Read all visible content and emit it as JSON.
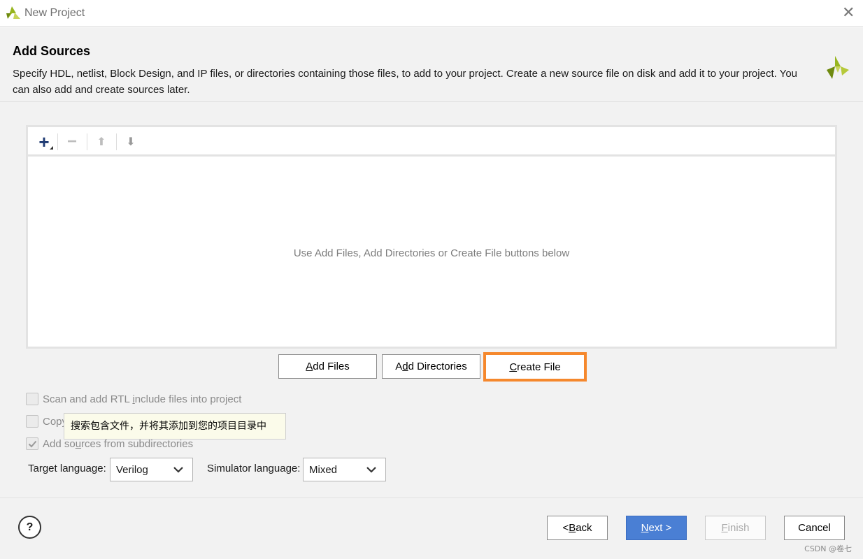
{
  "window": {
    "title": "New Project",
    "close_glyph": "✕"
  },
  "header": {
    "title": "Add Sources",
    "description": "Specify HDL, netlist, Block Design, and IP files, or directories containing those files, to add to your project. Create a new source file on disk and add it to your project. You can also add and create sources later."
  },
  "toolbar": {
    "add": "+",
    "remove": "−",
    "up": "⬆",
    "down": "⬇"
  },
  "panel": {
    "empty_message": "Use Add Files, Add Directories or Create File buttons below"
  },
  "buttons": {
    "add_files": {
      "mnemonic": "A",
      "rest": "dd Files"
    },
    "add_directories": {
      "pre": "A",
      "mnemonic": "d",
      "rest": "d Directories"
    },
    "create_file": {
      "mnemonic": "C",
      "rest": "reate File"
    }
  },
  "options": {
    "scan_rtl": {
      "pre": "Scan and add RTL ",
      "mnemonic": "i",
      "rest": "nclude files into project",
      "checked": false
    },
    "copy_sources": {
      "label": "Copy",
      "checked": false
    },
    "add_subdirs": {
      "pre": "Add so",
      "mnemonic": "u",
      "rest": "rces from subdirectories",
      "checked": true
    }
  },
  "tooltip": "搜索包含文件，并将其添加到您的项目目录中",
  "language": {
    "target_label": "Target language:",
    "target_value": "Verilog",
    "simulator_label": "Simulator language:",
    "simulator_value": "Mixed"
  },
  "footer": {
    "help": "?",
    "back": {
      "pre": "< ",
      "mnemonic": "B",
      "rest": "ack"
    },
    "next": {
      "mnemonic": "N",
      "rest": "ext >"
    },
    "finish": {
      "mnemonic": "F",
      "rest": "inish"
    },
    "cancel": "Cancel"
  },
  "watermark": "CSDN @卷七",
  "colors": {
    "highlight": "#f5882d",
    "primary": "#4a7fd4",
    "logo_green": "#97b51f"
  }
}
